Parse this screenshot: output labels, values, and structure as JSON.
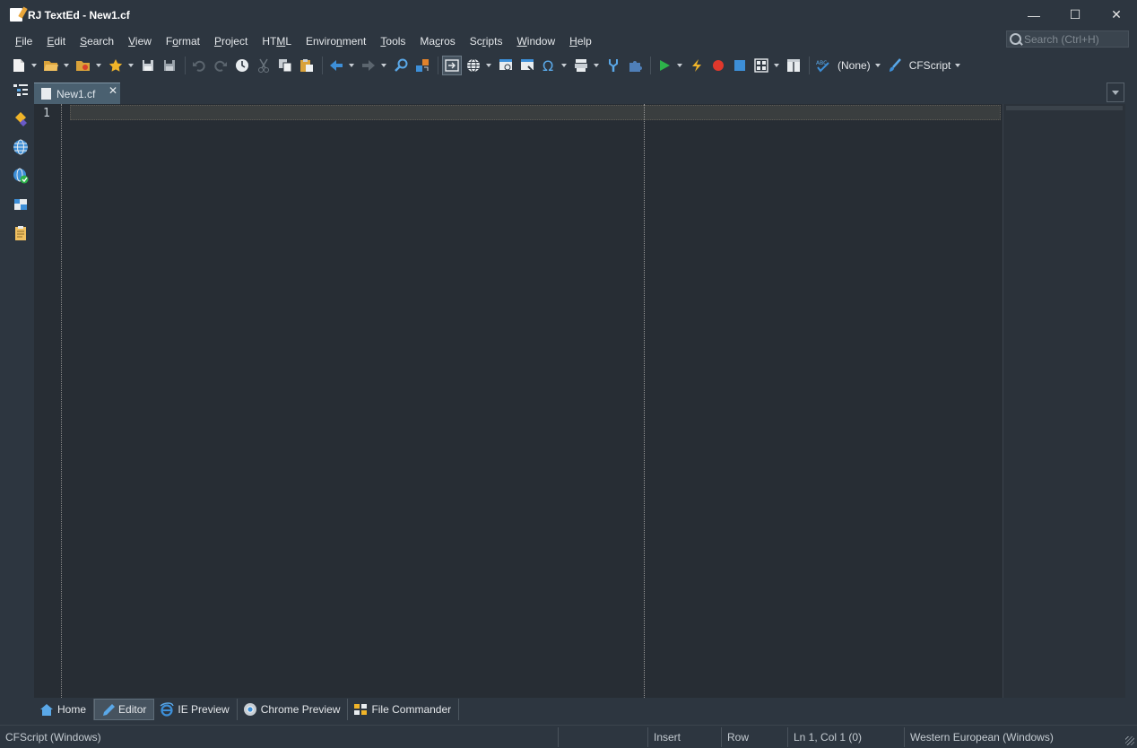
{
  "window": {
    "title": "RJ TextEd - New1.cf",
    "controls": {
      "minimize": "—",
      "maximize": "☐",
      "close": "✕"
    }
  },
  "menu": [
    {
      "label": "File",
      "mnemonic": "F",
      "rest": "ile"
    },
    {
      "label": "Edit",
      "mnemonic": "E",
      "rest": "dit"
    },
    {
      "label": "Search",
      "mnemonic": "S",
      "rest": "earch"
    },
    {
      "label": "View",
      "mnemonic": "V",
      "rest": "iew"
    },
    {
      "label": "Format",
      "pre": "F",
      "mnemonic": "o",
      "rest": "rmat"
    },
    {
      "label": "Project",
      "mnemonic": "P",
      "rest": "roject"
    },
    {
      "label": "HTML",
      "pre": "HT",
      "mnemonic": "M",
      "rest": "L"
    },
    {
      "label": "Environment",
      "pre": "Enviro",
      "mnemonic": "n",
      "rest": "ment"
    },
    {
      "label": "Tools",
      "mnemonic": "T",
      "rest": "ools"
    },
    {
      "label": "Macros",
      "pre": "Ma",
      "mnemonic": "c",
      "rest": "ros"
    },
    {
      "label": "Scripts",
      "pre": "Sc",
      "mnemonic": "r",
      "rest": "ipts"
    },
    {
      "label": "Window",
      "mnemonic": "W",
      "rest": "indow"
    },
    {
      "label": "Help",
      "mnemonic": "H",
      "rest": "elp"
    }
  ],
  "search": {
    "placeholder": "Search (Ctrl+H)"
  },
  "toolbar": {
    "spell_label": "(None)",
    "syntax_label": "CFScript"
  },
  "tabs": [
    {
      "label": "New1.cf",
      "close": "✕"
    }
  ],
  "editor": {
    "line_numbers": [
      "1"
    ]
  },
  "bottom_tabs": [
    {
      "label": "Home",
      "icon": "home-icon"
    },
    {
      "label": "Editor",
      "icon": "pen-icon"
    },
    {
      "label": "IE Preview",
      "icon": "ie-icon"
    },
    {
      "label": "Chrome Preview",
      "icon": "chrome-icon"
    },
    {
      "label": "File Commander",
      "icon": "file-commander-icon"
    }
  ],
  "status": {
    "syntax": "CFScript (Windows)",
    "empty": "",
    "mode": "Insert",
    "selection": "Row",
    "position": "Ln 1, Col 1 (0)",
    "encoding": "Western European (Windows)"
  },
  "colors": {
    "background": "#2d3640",
    "editor": "#272d34",
    "tab_active": "#4a6070",
    "accent_blue": "#3d8fd8",
    "accent_green": "#2db34a",
    "accent_red": "#e0382c"
  }
}
